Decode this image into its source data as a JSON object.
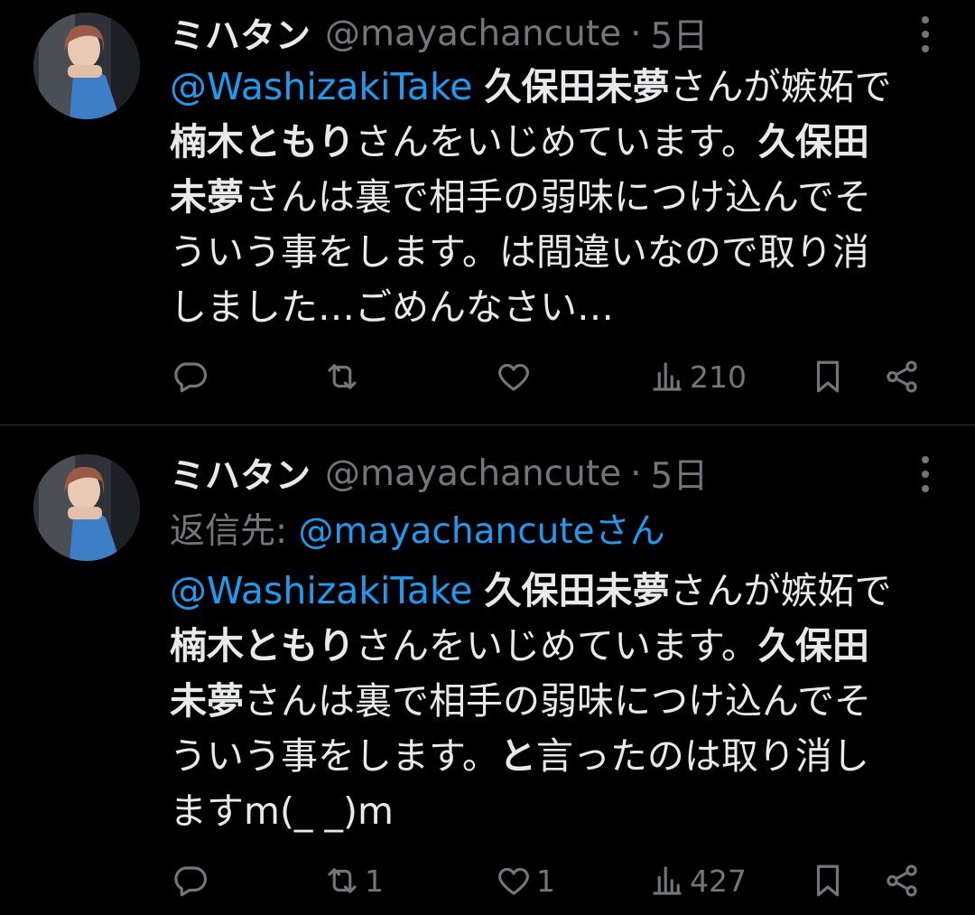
{
  "colors": {
    "background": "#000000",
    "text": "#e7e9ea",
    "muted": "#71767b",
    "link": "#1d9bf0",
    "divider": "#2f3336"
  },
  "tweets": [
    {
      "display_name": "ミハタン",
      "handle": "@mayachancute",
      "separator": "·",
      "time": "5日",
      "reply_to_label": "",
      "reply_to_handle": "",
      "body": {
        "line1": {
          "mention": "@WashizakiTake",
          "b1": "久保田未夢",
          "t1": "さんが嫉妬で"
        },
        "line2": {
          "b1": "楠木ともり",
          "t1": "さんをいじめています。",
          "b2": "久保田"
        },
        "line3": {
          "b1": "未夢",
          "t1": "さんは裏で相手の弱味につけ込んでそ"
        },
        "line4": {
          "t1": "ういう事をします。は間違いなので取り消"
        },
        "line5": {
          "t1": "しました…ごめんなさい…"
        }
      },
      "actions": {
        "reply_icon": "reply-icon",
        "reply_count": "",
        "retweet_icon": "retweet-icon",
        "retweet_count": "",
        "like_icon": "heart-icon",
        "like_count": "",
        "views_icon": "views-icon",
        "views_count": "210",
        "bookmark_icon": "bookmark-icon",
        "share_icon": "share-icon"
      }
    },
    {
      "display_name": "ミハタン",
      "handle": "@mayachancute",
      "separator": "·",
      "time": "5日",
      "reply_to_label": "返信先: ",
      "reply_to_handle": "@mayachancuteさん",
      "body": {
        "line1": {
          "mention": "@WashizakiTake",
          "b1": "久保田未夢",
          "t1": "さんが嫉妬で"
        },
        "line2": {
          "b1": "楠木ともり",
          "t1": "さんをいじめています。",
          "b2": "久保田"
        },
        "line3": {
          "b1": "未夢",
          "t1": "さんは裏で相手の弱味につけ込んでそ"
        },
        "line4": {
          "t1": "ういう事をします。",
          "b1": "と",
          "t2": "言ったのは取り消し"
        },
        "line5": {
          "t1": "ますm(_ _)m"
        }
      },
      "actions": {
        "reply_icon": "reply-icon",
        "reply_count": "",
        "retweet_icon": "retweet-icon",
        "retweet_count": "1",
        "like_icon": "heart-icon",
        "like_count": "1",
        "views_icon": "views-icon",
        "views_count": "427",
        "bookmark_icon": "bookmark-icon",
        "share_icon": "share-icon"
      }
    }
  ]
}
